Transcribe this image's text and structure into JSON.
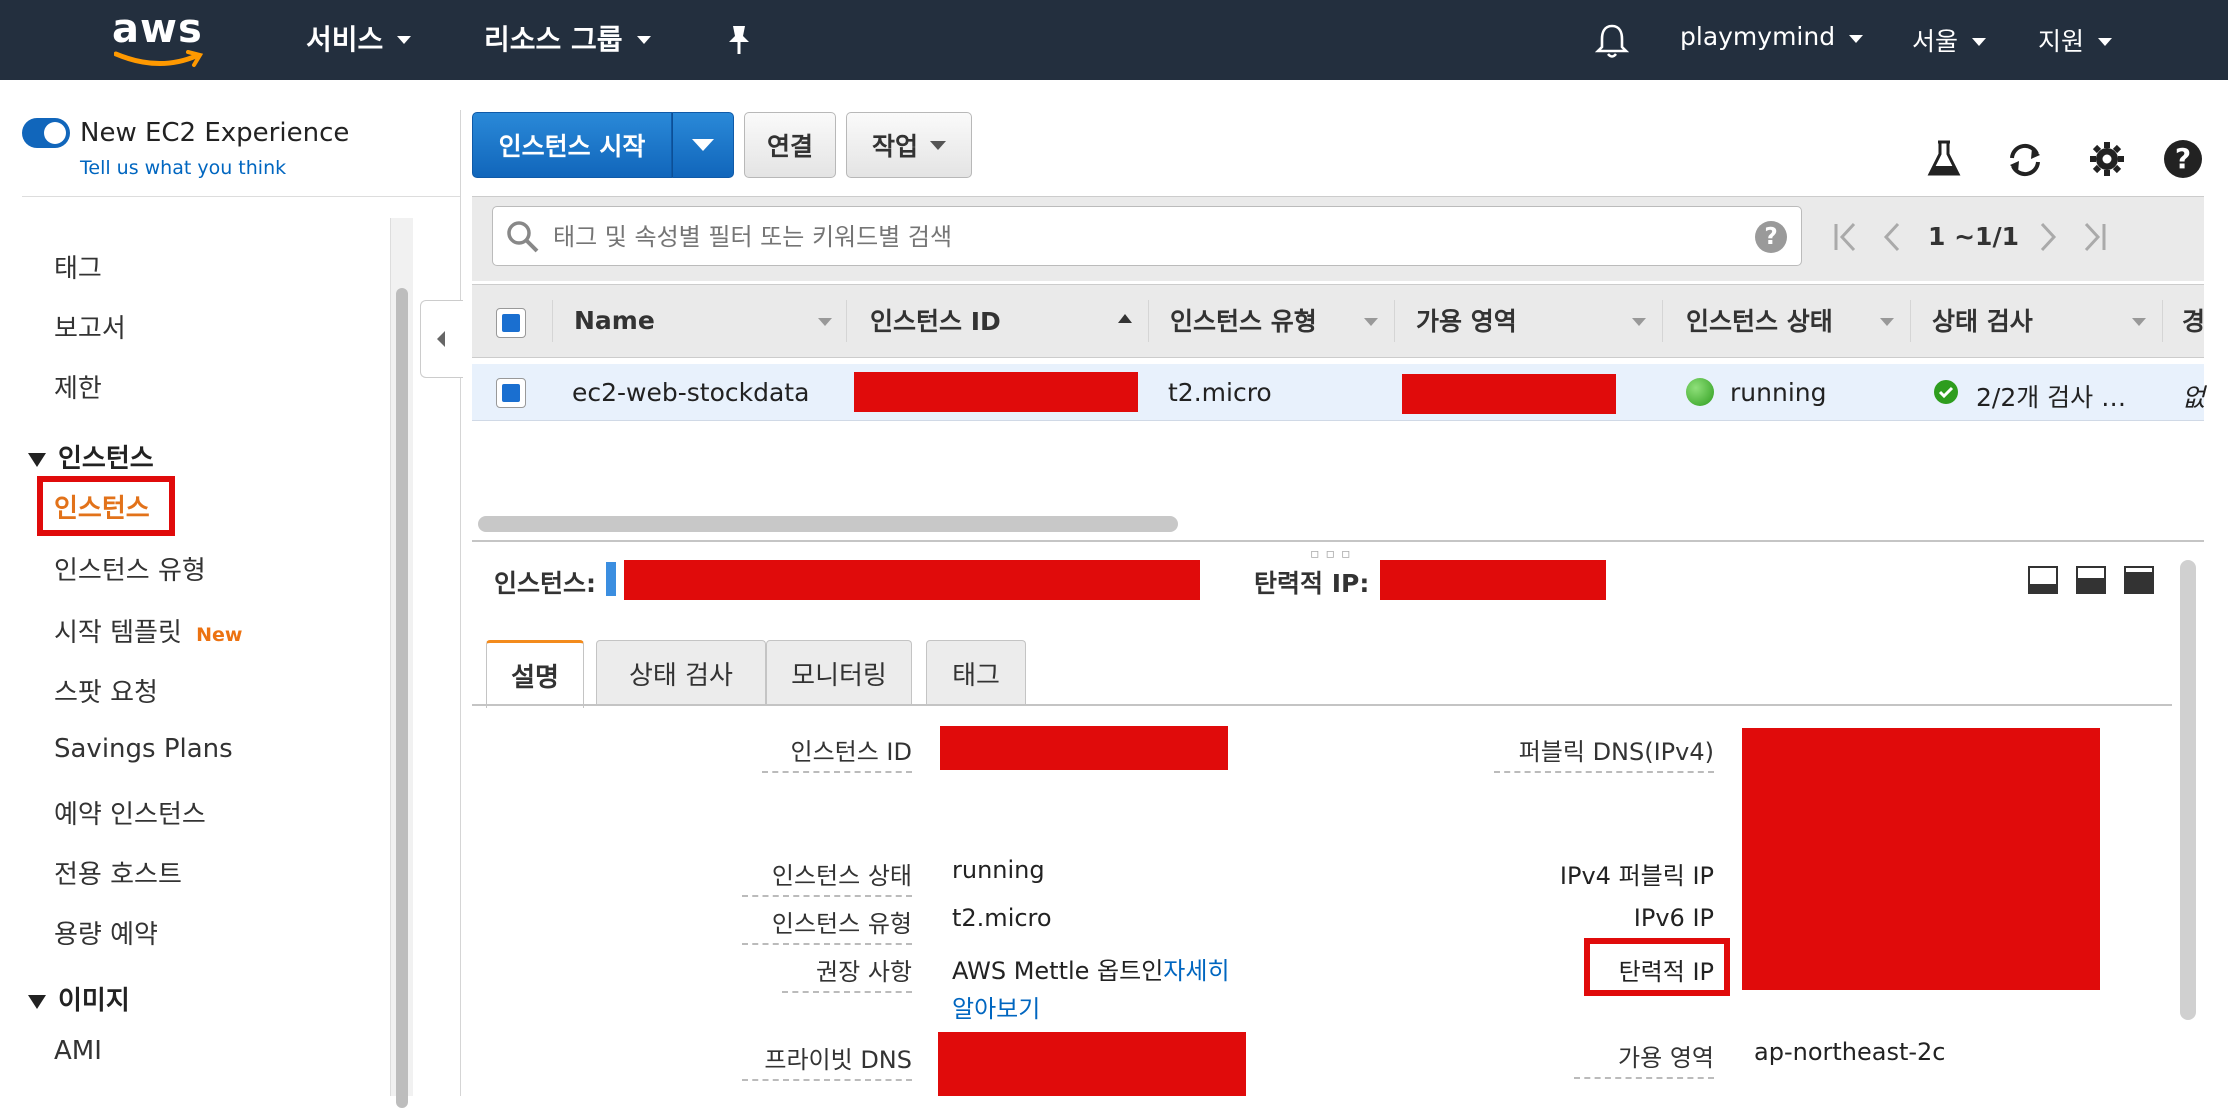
{
  "nav": {
    "logo": "aws",
    "services": "서비스",
    "resource_groups": "리소스 그룹",
    "user": "playmymind",
    "region": "서울",
    "support": "지원"
  },
  "sidebar": {
    "toggle_label": "New EC2 Experience",
    "feedback_link": "Tell us what you think",
    "items_top": [
      "태그",
      "보고서",
      "제한"
    ],
    "section_instances": "인스턴스",
    "instances_items": [
      "인스턴스",
      "인스턴스 유형",
      "시작 템플릿",
      "스팟 요청",
      "Savings Plans",
      "예약 인스턴스",
      "전용 호스트",
      "용량 예약"
    ],
    "new_badge": "New",
    "section_images": "이미지",
    "images_items": [
      "AMI"
    ]
  },
  "toolbar": {
    "launch": "인스턴스 시작",
    "connect": "연결",
    "actions": "작업"
  },
  "filter": {
    "placeholder": "태그 및 속성별 필터 또는 키워드별 검색",
    "pagination": "1 ~1/1"
  },
  "table": {
    "columns": [
      "Name",
      "인스턴스 ID",
      "인스턴스 유형",
      "가용 영역",
      "인스턴스 상태",
      "상태 검사",
      "경"
    ],
    "row": {
      "name": "ec2-web-stockdata",
      "type": "t2.micro",
      "state": "running",
      "checks": "2/2개 검사 …",
      "alarm": "없"
    }
  },
  "detail": {
    "instance_label": "인스턴스:",
    "eip_label": "탄력적 IP:",
    "tabs": [
      "설명",
      "상태 검사",
      "모니터링",
      "태그"
    ],
    "left": {
      "instance_id": "인스턴스 ID",
      "instance_state": "인스턴스 상태",
      "instance_state_val": "running",
      "instance_type": "인스턴스 유형",
      "instance_type_val": "t2.micro",
      "recommendation": "권장 사항",
      "recommendation_text": "AWS Mettle 옵트인",
      "recommendation_link1": "자세히",
      "recommendation_link2": "알아보기",
      "private_dns": "프라이빗 DNS"
    },
    "right": {
      "public_dns": "퍼블릭 DNS(IPv4)",
      "ipv4_public": "IPv4 퍼블릭 IP",
      "ipv6": "IPv6 IP",
      "elastic_ip": "탄력적 IP",
      "az": "가용 영역",
      "az_val": "ap-northeast-2c"
    }
  },
  "colors": {
    "nav_bg": "#232f3e",
    "primary": "#1166bb",
    "accent_orange": "#f38b1d",
    "highlight_red": "#e00b0b",
    "running_green": "#3cb02d"
  }
}
